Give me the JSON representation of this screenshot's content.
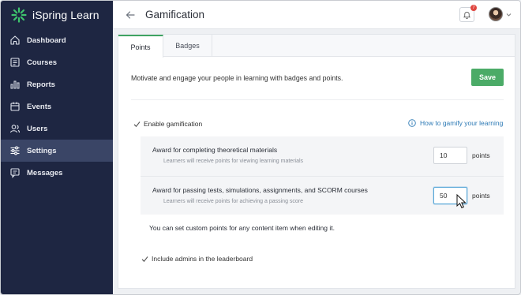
{
  "app": {
    "name": "iSpring Learn",
    "accent": "#4bab67",
    "sidebar_bg": "#1e2642"
  },
  "sidebar": {
    "items": [
      {
        "label": "Dashboard",
        "icon": "home-icon"
      },
      {
        "label": "Courses",
        "icon": "courses-icon"
      },
      {
        "label": "Reports",
        "icon": "reports-icon"
      },
      {
        "label": "Events",
        "icon": "calendar-icon"
      },
      {
        "label": "Users",
        "icon": "users-icon"
      },
      {
        "label": "Settings",
        "icon": "settings-sliders-icon",
        "active": true
      },
      {
        "label": "Messages",
        "icon": "messages-icon"
      }
    ]
  },
  "header": {
    "title": "Gamification",
    "notifications_count": "7"
  },
  "tabs": [
    {
      "label": "Points",
      "active": true
    },
    {
      "label": "Badges"
    }
  ],
  "main": {
    "description": "Motivate and engage your people in learning with badges and points.",
    "save_label": "Save",
    "enable_label": "Enable gamification",
    "enable_checked": true,
    "howto_link": "How to gamify your learning",
    "awards": [
      {
        "title": "Award for completing theoretical materials",
        "subtitle": "Learners will receive points for viewing learning materials",
        "value": "10",
        "unit": "points"
      },
      {
        "title": "Award for passing tests, simulations, assignments, and SCORM courses",
        "subtitle": "Learners will receive points for achieving a passing score",
        "value": "50",
        "unit": "points"
      }
    ],
    "custom_note": "You can set custom points for any content item when editing it.",
    "leaderboard_label": "Include admins in the leaderboard",
    "leaderboard_checked": true
  }
}
